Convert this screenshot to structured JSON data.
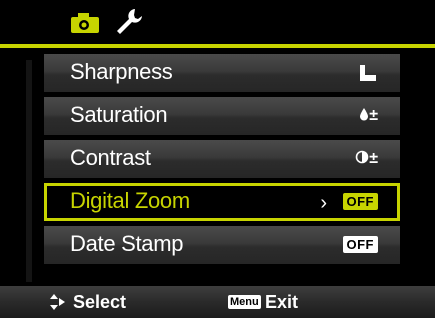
{
  "tabs": {
    "camera_icon": "camera-icon",
    "setup_icon": "wrench-icon"
  },
  "menu": {
    "items": [
      {
        "label": "Sharpness",
        "value_icon": "sharpness-icon"
      },
      {
        "label": "Saturation",
        "value_text": "±",
        "value_icon": "saturation-icon"
      },
      {
        "label": "Contrast",
        "value_text": "±",
        "value_icon": "contrast-icon"
      },
      {
        "label": "Digital Zoom",
        "value": "OFF",
        "arrow": "›"
      },
      {
        "label": "Date Stamp",
        "value": "OFF"
      }
    ],
    "selected_index": 3
  },
  "footer": {
    "nav_icon": "up-down-arrow-icon",
    "select_label": "Select",
    "menu_key": "Menu",
    "exit_label": "Exit"
  },
  "colors": {
    "accent": "#c7d400",
    "background": "#000000",
    "text": "#ffffff"
  }
}
